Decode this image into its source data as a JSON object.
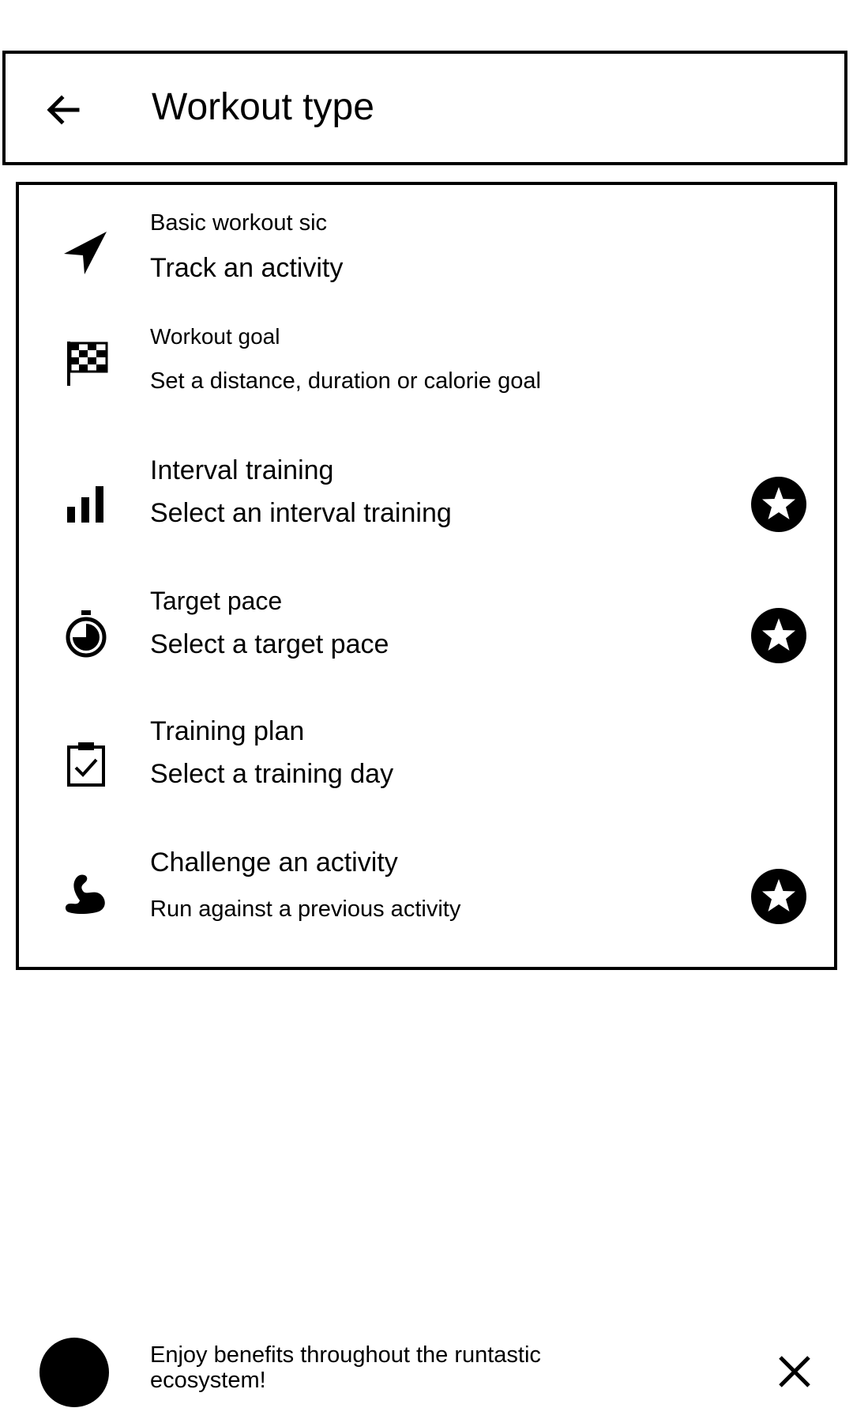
{
  "header": {
    "title": "Workout type",
    "back_icon": "arrow-back-icon"
  },
  "items": [
    {
      "title": "Basic workout sic",
      "subtitle": "Track an activity",
      "icon": "navigation-arrow-icon",
      "premium": false
    },
    {
      "title": "Workout goal",
      "subtitle": "Set a distance, duration or calorie goal",
      "icon": "checkered-flag-icon",
      "premium": false
    },
    {
      "title": "Interval training",
      "subtitle": "Select an interval training",
      "icon": "bar-chart-icon",
      "premium": true
    },
    {
      "title": "Target pace",
      "subtitle": "Select a target pace",
      "icon": "stopwatch-icon",
      "premium": true
    },
    {
      "title": "Training plan",
      "subtitle": "Select a training day",
      "icon": "clipboard-check-icon",
      "premium": false
    },
    {
      "title": "Challenge an activity",
      "subtitle": "Run against a previous activity",
      "icon": "flexed-arm-icon",
      "premium": true
    }
  ],
  "promo": {
    "text": "Enjoy benefits throughout the runtastic ecosystem!",
    "close_icon": "close-icon"
  }
}
